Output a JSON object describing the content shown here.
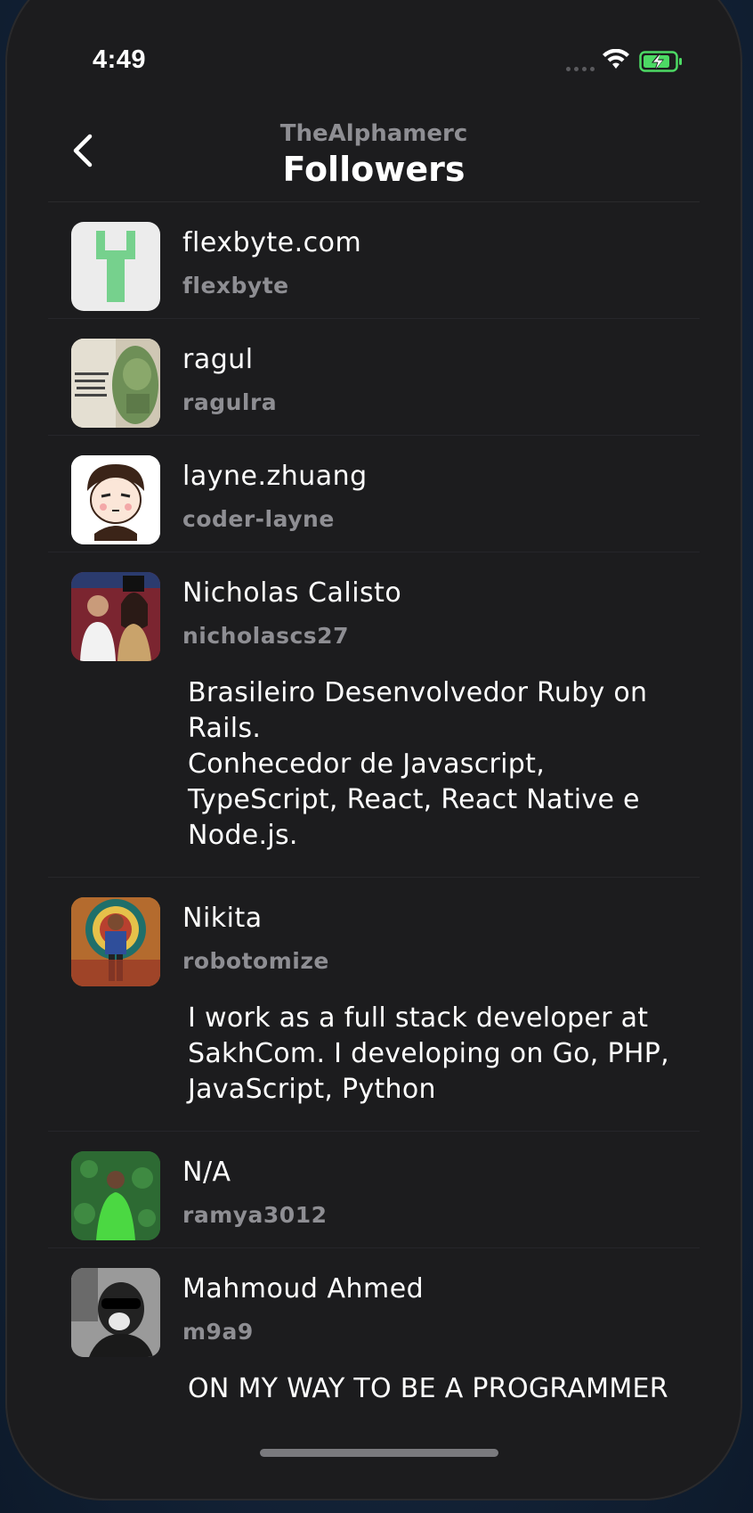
{
  "status_bar": {
    "time": "4:49"
  },
  "header": {
    "subtitle": "TheAlphamerc",
    "title": "Followers"
  },
  "followers": [
    {
      "name": "flexbyte.com",
      "login": "flexbyte",
      "bio": ""
    },
    {
      "name": "ragul",
      "login": "ragulra",
      "bio": ""
    },
    {
      "name": "layne.zhuang",
      "login": "coder-layne",
      "bio": ""
    },
    {
      "name": "Nicholas Calisto",
      "login": "nicholascs27",
      "bio": "Brasileiro Desenvolvedor Ruby on Rails.\nConhecedor de Javascript, TypeScript, React, React Native e Node.js."
    },
    {
      "name": "Nikita",
      "login": "robotomize",
      "bio": "I work as a full stack developer at SakhCom. I developing on Go, PHP, JavaScript, Python"
    },
    {
      "name": "N/A",
      "login": "ramya3012",
      "bio": ""
    },
    {
      "name": "Mahmoud Ahmed",
      "login": "m9a9",
      "bio": "ON MY WAY TO BE A PROGRAMMER"
    }
  ],
  "colors": {
    "background": "#1c1c1e",
    "secondary_text": "#8e8e93",
    "accent_battery": "#4cd964"
  }
}
